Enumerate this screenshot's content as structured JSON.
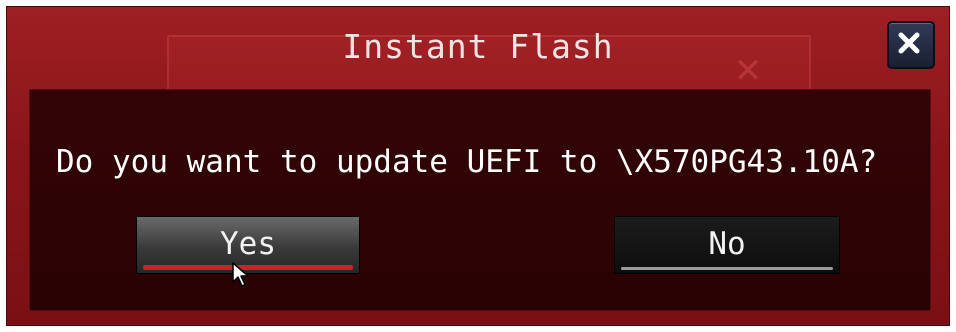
{
  "dialog": {
    "title": "Instant Flash",
    "close_icon": "close-icon",
    "message": "Do you want to update UEFI to \\X570PG43.10A?",
    "buttons": {
      "yes_label": "Yes",
      "no_label": "No"
    },
    "selected_button": "Yes"
  },
  "colors": {
    "frame": "#8a1519",
    "panel": "#2a0204",
    "close_button": "#1f2640",
    "selected_underline": "#c8232b"
  }
}
